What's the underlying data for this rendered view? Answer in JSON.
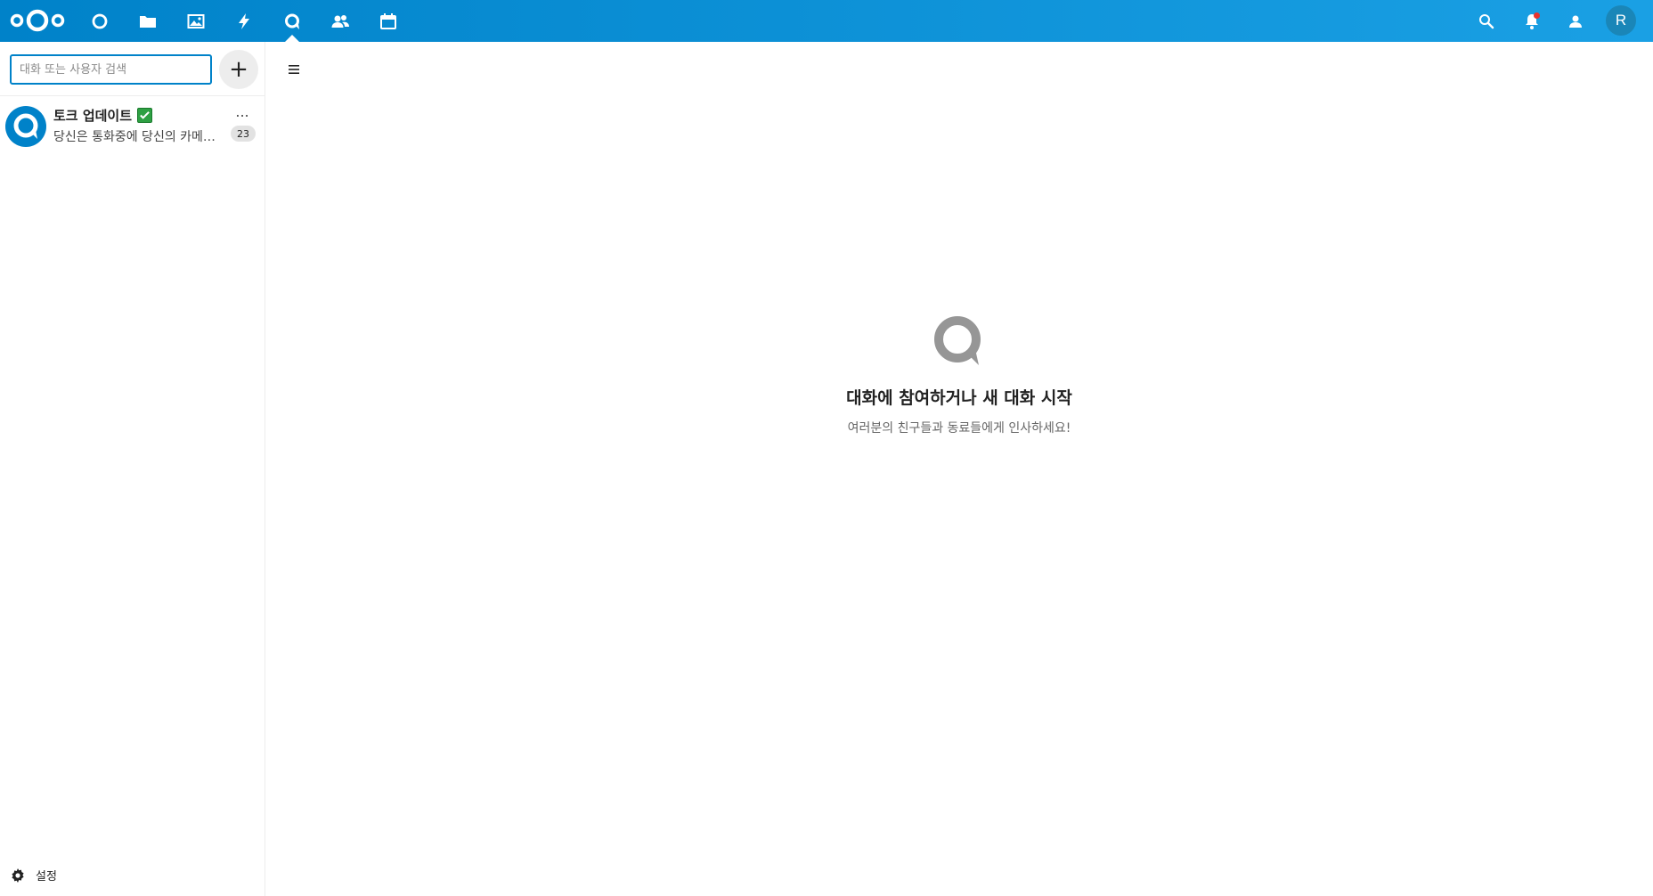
{
  "header": {
    "apps": [
      {
        "name": "dashboard",
        "icon": "dashboard-icon"
      },
      {
        "name": "files",
        "icon": "folder-icon"
      },
      {
        "name": "photos",
        "icon": "image-icon"
      },
      {
        "name": "activity",
        "icon": "lightning-icon"
      },
      {
        "name": "talk",
        "icon": "talk-icon",
        "active": true
      },
      {
        "name": "contacts",
        "icon": "contacts-icon"
      },
      {
        "name": "calendar",
        "icon": "calendar-icon"
      }
    ],
    "right_icons": [
      "search-icon",
      "bell-icon",
      "contacts-menu-icon"
    ],
    "avatar_initial": "R",
    "colors": {
      "gradient_start": "#0082c9",
      "gradient_end": "#1aa0e4",
      "notification_dot": "#e9322d"
    }
  },
  "sidebar": {
    "search": {
      "placeholder": "대화 또는 사용자 검색",
      "value": ""
    },
    "add_label": "+",
    "conversations": [
      {
        "name": "토크 업데이트",
        "badge_icon": "check-mark-icon",
        "last_message": "당신은 통화중에 당신의 카메라를 끄고 켤 수 있습니다",
        "unread": "23",
        "menu_label": "..."
      }
    ],
    "settings_label": "설정"
  },
  "main": {
    "empty_title": "대화에 참여하거나 새 대화 시작",
    "empty_subtitle": "여러분의 친구들과 동료들에게 인사하세요!"
  }
}
